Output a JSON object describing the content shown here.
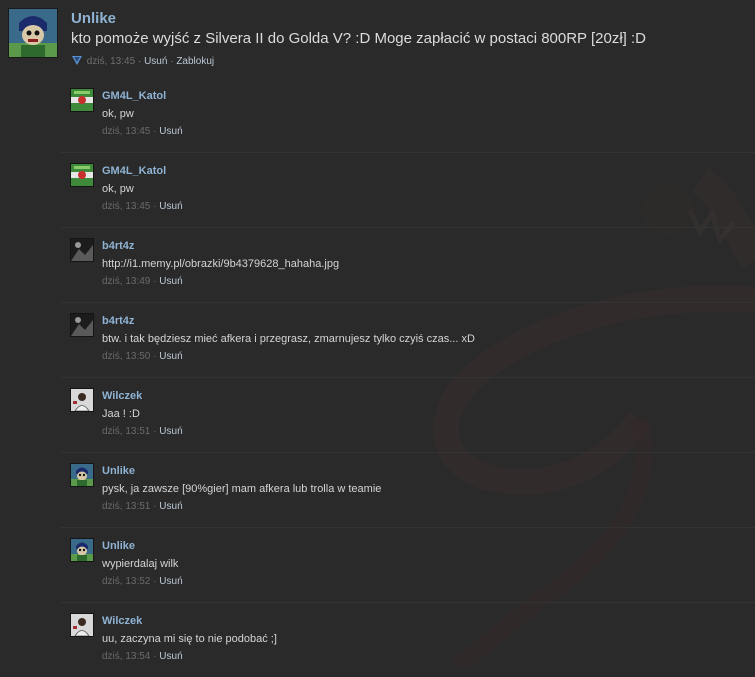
{
  "post": {
    "author": "Unlike",
    "text": "kto pomoże wyjść z Silvera II do Golda V? :D Moge zapłacić w postaci 800RP [20zł] :D",
    "time": "dziś, 13:45",
    "sep": "·",
    "delete_label": "Usuń",
    "block_label": "Zablokuj",
    "avatar_icon": "cartoon-avatar-icon"
  },
  "comments": [
    {
      "author": "GM4L_Katol",
      "text": "ok, pw",
      "time": "dziś, 13:45",
      "sep": "·",
      "delete_label": "Usuń",
      "avatar_icon": "green-flag-avatar-icon"
    },
    {
      "author": "GM4L_Katol",
      "text": "ok, pw",
      "time": "dziś, 13:45",
      "sep": "·",
      "delete_label": "Usuń",
      "avatar_icon": "green-flag-avatar-icon"
    },
    {
      "author": "b4rt4z",
      "text": "http://i1.memy.pl/obrazki/9b4379628_hahaha.jpg",
      "time": "dziś, 13:49",
      "sep": "·",
      "delete_label": "Usuń",
      "avatar_icon": "dark-avatar-icon"
    },
    {
      "author": "b4rt4z",
      "text": "btw. i tak będziesz mieć afkera i przegrasz, zmarnujesz tylko czyiś czas... xD",
      "time": "dziś, 13:50",
      "sep": "·",
      "delete_label": "Usuń",
      "avatar_icon": "dark-avatar-icon"
    },
    {
      "author": "Wilczek",
      "text": "Jaa ! :D",
      "time": "dziś, 13:51",
      "sep": "·",
      "delete_label": "Usuń",
      "avatar_icon": "person-avatar-icon"
    },
    {
      "author": "Unlike",
      "text": "pysk, ja zawsze [90%gier] mam afkera lub trolla w teamie",
      "time": "dziś, 13:51",
      "sep": "·",
      "delete_label": "Usuń",
      "avatar_icon": "cartoon-avatar-icon"
    },
    {
      "author": "Unlike",
      "text": "wypierdalaj wilk",
      "time": "dziś, 13:52",
      "sep": "·",
      "delete_label": "Usuń",
      "avatar_icon": "cartoon-avatar-icon"
    },
    {
      "author": "Wilczek",
      "text": "uu, zaczyna mi się to nie podobać ;]",
      "time": "dziś, 13:54",
      "sep": "·",
      "delete_label": "Usuń",
      "avatar_icon": "person-avatar-icon"
    }
  ],
  "colors": {
    "background": "#2a2a2a",
    "author_link": "#8fb3d4",
    "text": "#d4d4d4",
    "meta": "#6a6a6a"
  }
}
